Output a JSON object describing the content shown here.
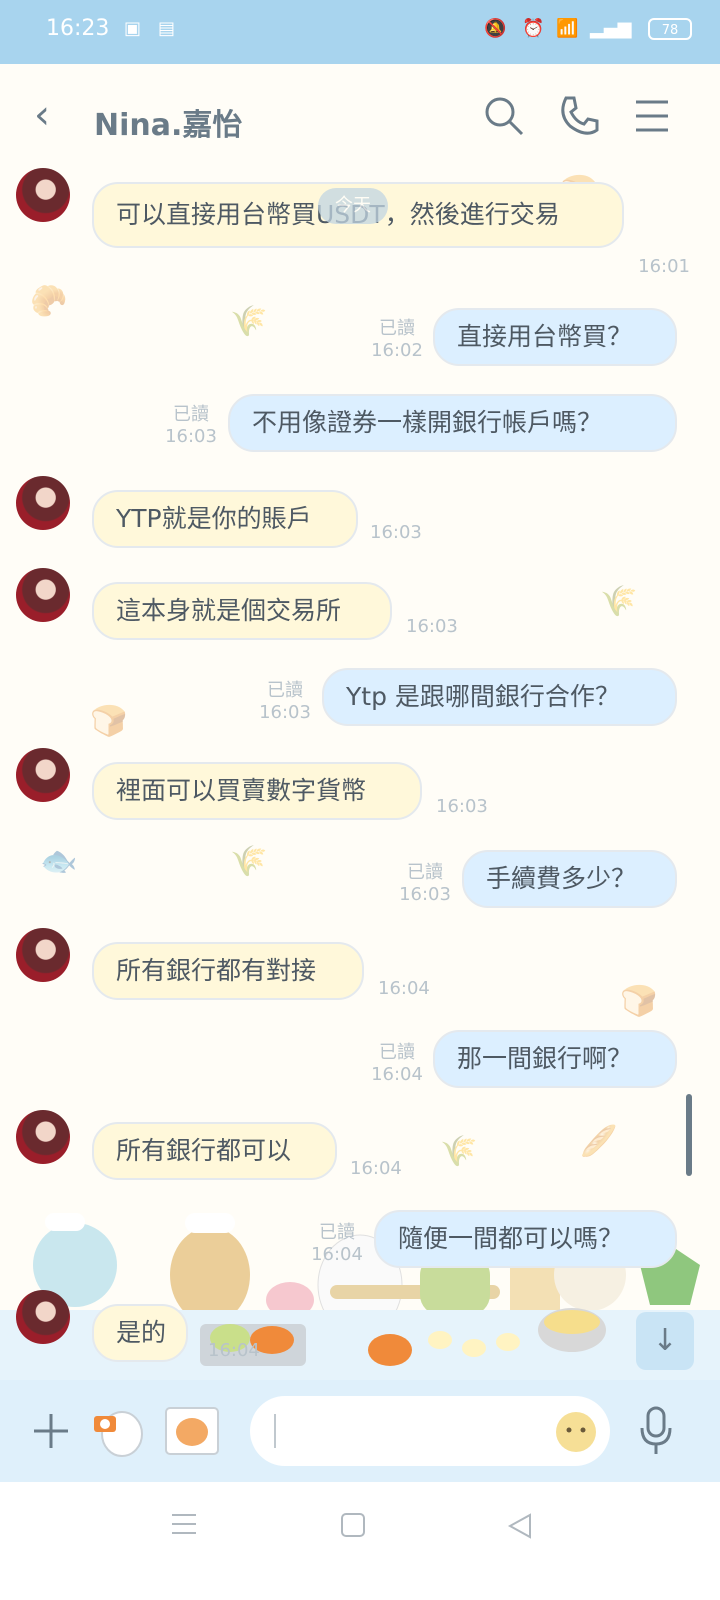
{
  "status_bar": {
    "time": "16:23",
    "battery": "78"
  },
  "header": {
    "title": "Nina.嘉怡"
  },
  "date_divider": "今天",
  "messages": [
    {
      "dir": "in",
      "text": "可以直接用台幣買USDT，然後進行交易",
      "time": "16:01"
    },
    {
      "dir": "out",
      "text": "直接用台幣買？",
      "time": "16:02",
      "read": "已讀"
    },
    {
      "dir": "out",
      "text": "不用像證券一樣開銀行帳戶嗎？",
      "time": "16:03",
      "read": "已讀"
    },
    {
      "dir": "in",
      "text": "YTP就是你的賬戶",
      "time": "16:03"
    },
    {
      "dir": "in",
      "text": "這本身就是個交易所",
      "time": "16:03"
    },
    {
      "dir": "out",
      "text": "Ytp 是跟哪間銀行合作？",
      "time": "16:03",
      "read": "已讀"
    },
    {
      "dir": "in",
      "text": "裡面可以買賣數字貨幣",
      "time": "16:03"
    },
    {
      "dir": "out",
      "text": "手續費多少？",
      "time": "16:03",
      "read": "已讀"
    },
    {
      "dir": "in",
      "text": "所有銀行都有對接",
      "time": "16:04"
    },
    {
      "dir": "out",
      "text": "那一間銀行啊？",
      "time": "16:04",
      "read": "已讀"
    },
    {
      "dir": "in",
      "text": "所有銀行都可以",
      "time": "16:04"
    },
    {
      "dir": "out",
      "text": "隨便一間都可以嗎？",
      "time": "16:04",
      "read": "已讀"
    },
    {
      "dir": "in",
      "text": "是的",
      "time": "16:04"
    }
  ],
  "icons": {
    "back": "chevron-left-icon",
    "search": "search-icon",
    "call": "phone-icon",
    "menu": "hamburger-menu-icon",
    "add": "plus-icon",
    "camera": "camera-icon",
    "gallery": "image-icon",
    "emoji": "sticker-icon",
    "mic": "microphone-icon",
    "scroll_down": "arrow-down-icon"
  },
  "colors": {
    "status_bar": "#a8d4ee",
    "incoming_bubble": "#fff8da",
    "outgoing_bubble": "#dcefff",
    "input_bar": "#dff0fb",
    "text": "#4e5963"
  }
}
